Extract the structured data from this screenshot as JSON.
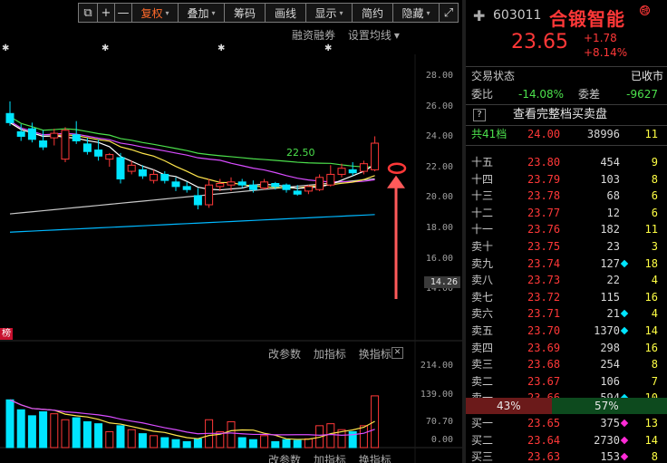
{
  "toolbar": {
    "items": [
      {
        "label": "复权",
        "dropdown": true,
        "active": true
      },
      {
        "label": "叠加",
        "dropdown": true,
        "active": false
      },
      {
        "label": "筹码",
        "dropdown": false,
        "active": false
      },
      {
        "label": "画线",
        "dropdown": false,
        "active": false
      },
      {
        "label": "显示",
        "dropdown": true,
        "active": false
      },
      {
        "label": "简约",
        "dropdown": false,
        "active": false
      },
      {
        "label": "隐藏",
        "dropdown": true,
        "active": false
      }
    ],
    "icons": [
      "copy-icon",
      "plus-icon",
      "minus-icon",
      "fullscreen-icon"
    ]
  },
  "chart_links": {
    "margin": "融资融券",
    "ma_setting": "设置均线",
    "ma_setting_arrow": "▾"
  },
  "price_axis": [
    "28.00",
    "26.00",
    "24.00",
    "22.00",
    "20.00",
    "18.00",
    "16.00",
    "14.00"
  ],
  "current_price_tag": "14.26",
  "ma_label": "22.50",
  "rank_tag": "榜",
  "indicator_links": {
    "params": "改参数",
    "add": "加指标",
    "switch": "换指标",
    "close": "✕"
  },
  "volume_axis": [
    "214.00",
    "139.00",
    "70.70",
    "0.00"
  ],
  "quote": {
    "code": "603011",
    "name": "合锻智能",
    "badge": "融",
    "price": "23.65",
    "change": "+1.78",
    "change_pct": "+8.14%",
    "trade_status_label": "交易状态",
    "trade_status_value": "已收市",
    "weibi_label": "委比",
    "weibi_value": "-14.08%",
    "weicha_label": "委差",
    "weicha_value": "-9627",
    "help_icon": "?",
    "full_book_link": "查看完整档买卖盘",
    "total_label": "共41档",
    "total_price": "24.00",
    "total_qty": "38996",
    "total_count": "11",
    "sell_levels": [
      {
        "level": "十五",
        "price": "23.80",
        "qty": "454",
        "mark": "",
        "count": "9"
      },
      {
        "level": "十四",
        "price": "23.79",
        "qty": "103",
        "mark": "",
        "count": "8"
      },
      {
        "level": "十三",
        "price": "23.78",
        "qty": "68",
        "mark": "",
        "count": "6"
      },
      {
        "level": "十二",
        "price": "23.77",
        "qty": "12",
        "mark": "",
        "count": "6"
      },
      {
        "level": "十一",
        "price": "23.76",
        "qty": "182",
        "mark": "",
        "count": "11"
      },
      {
        "level": "卖十",
        "price": "23.75",
        "qty": "23",
        "mark": "",
        "count": "3"
      },
      {
        "level": "卖九",
        "price": "23.74",
        "qty": "127",
        "mark": "cyan",
        "count": "18"
      },
      {
        "level": "卖八",
        "price": "23.73",
        "qty": "22",
        "mark": "",
        "count": "4"
      },
      {
        "level": "卖七",
        "price": "23.72",
        "qty": "115",
        "mark": "",
        "count": "16"
      },
      {
        "level": "卖六",
        "price": "23.71",
        "qty": "21",
        "mark": "cyan",
        "count": "4"
      },
      {
        "level": "卖五",
        "price": "23.70",
        "qty": "1370",
        "mark": "cyan",
        "count": "14"
      },
      {
        "level": "卖四",
        "price": "23.69",
        "qty": "298",
        "mark": "",
        "count": "16"
      },
      {
        "level": "卖三",
        "price": "23.68",
        "qty": "254",
        "mark": "",
        "count": "8"
      },
      {
        "level": "卖二",
        "price": "23.67",
        "qty": "106",
        "mark": "",
        "count": "7"
      },
      {
        "level": "卖一",
        "price": "23.66",
        "qty": "594",
        "mark": "cyan",
        "count": "10"
      }
    ],
    "ratio_buy": "43%",
    "ratio_sell": "57%",
    "buy_levels": [
      {
        "level": "买一",
        "price": "23.65",
        "qty": "375",
        "mark": "magenta",
        "count": "13"
      },
      {
        "level": "买二",
        "price": "23.64",
        "qty": "2730",
        "mark": "magenta",
        "count": "14"
      },
      {
        "level": "买三",
        "price": "23.63",
        "qty": "153",
        "mark": "magenta",
        "count": "8"
      }
    ]
  },
  "colors": {
    "up": "#ff3838",
    "down": "#00e5ff",
    "ma5": "#ffffff",
    "ma10": "#ffe64c",
    "ma20": "#d84cff",
    "ma30": "#4ce04c",
    "ma60": "#c8c8c8",
    "ma120": "#00b8ff"
  },
  "chart_data": {
    "type": "candlestick",
    "ylim": [
      14,
      28
    ],
    "candles": [
      {
        "o": 25.6,
        "h": 26.4,
        "l": 24.8,
        "c": 25.0
      },
      {
        "o": 24.4,
        "h": 24.9,
        "l": 23.8,
        "c": 24.1
      },
      {
        "o": 24.6,
        "h": 25.0,
        "l": 23.7,
        "c": 23.9
      },
      {
        "o": 23.8,
        "h": 24.5,
        "l": 23.2,
        "c": 23.4
      },
      {
        "o": 24.0,
        "h": 24.6,
        "l": 23.5,
        "c": 24.3
      },
      {
        "o": 22.6,
        "h": 24.7,
        "l": 22.4,
        "c": 24.5
      },
      {
        "o": 24.2,
        "h": 25.1,
        "l": 23.6,
        "c": 23.8
      },
      {
        "o": 23.6,
        "h": 24.0,
        "l": 22.9,
        "c": 23.1
      },
      {
        "o": 23.2,
        "h": 23.9,
        "l": 22.5,
        "c": 22.8
      },
      {
        "o": 22.6,
        "h": 23.0,
        "l": 22.1,
        "c": 22.9
      },
      {
        "o": 22.7,
        "h": 23.0,
        "l": 21.0,
        "c": 21.3
      },
      {
        "o": 21.8,
        "h": 22.5,
        "l": 21.6,
        "c": 22.2
      },
      {
        "o": 21.9,
        "h": 22.2,
        "l": 21.3,
        "c": 21.5
      },
      {
        "o": 21.2,
        "h": 21.9,
        "l": 21.0,
        "c": 21.6
      },
      {
        "o": 21.6,
        "h": 21.8,
        "l": 21.0,
        "c": 21.2
      },
      {
        "o": 21.1,
        "h": 21.4,
        "l": 20.5,
        "c": 20.8
      },
      {
        "o": 20.8,
        "h": 21.1,
        "l": 20.4,
        "c": 20.6
      },
      {
        "o": 20.2,
        "h": 20.7,
        "l": 19.3,
        "c": 19.6
      },
      {
        "o": 19.6,
        "h": 21.3,
        "l": 19.4,
        "c": 20.9
      },
      {
        "o": 20.8,
        "h": 21.3,
        "l": 20.5,
        "c": 21.0
      },
      {
        "o": 20.9,
        "h": 21.4,
        "l": 20.5,
        "c": 21.1
      },
      {
        "o": 21.1,
        "h": 21.3,
        "l": 20.7,
        "c": 20.9
      },
      {
        "o": 20.9,
        "h": 21.2,
        "l": 20.4,
        "c": 20.6
      },
      {
        "o": 20.7,
        "h": 21.3,
        "l": 20.6,
        "c": 21.1
      },
      {
        "o": 21.0,
        "h": 21.1,
        "l": 20.6,
        "c": 20.8
      },
      {
        "o": 20.9,
        "h": 21.0,
        "l": 20.4,
        "c": 20.6
      },
      {
        "o": 20.5,
        "h": 20.9,
        "l": 20.2,
        "c": 20.3
      },
      {
        "o": 20.5,
        "h": 20.9,
        "l": 20.3,
        "c": 20.8
      },
      {
        "o": 20.6,
        "h": 21.6,
        "l": 20.5,
        "c": 21.4
      },
      {
        "o": 20.9,
        "h": 22.2,
        "l": 20.8,
        "c": 21.6
      },
      {
        "o": 21.6,
        "h": 22.3,
        "l": 21.4,
        "c": 22.0
      },
      {
        "o": 21.9,
        "h": 22.4,
        "l": 21.5,
        "c": 21.7
      },
      {
        "o": 21.8,
        "h": 22.5,
        "l": 21.6,
        "c": 22.3
      },
      {
        "o": 21.9,
        "h": 24.1,
        "l": 21.8,
        "c": 23.65
      }
    ],
    "volume": {
      "ylim": [
        0,
        214
      ],
      "values": [
        {
          "v": 120,
          "up": false
        },
        {
          "v": 95,
          "up": false
        },
        {
          "v": 80,
          "up": false
        },
        {
          "v": 90,
          "up": false
        },
        {
          "v": 85,
          "up": true
        },
        {
          "v": 70,
          "up": true
        },
        {
          "v": 75,
          "up": false
        },
        {
          "v": 65,
          "up": false
        },
        {
          "v": 60,
          "up": false
        },
        {
          "v": 40,
          "up": true
        },
        {
          "v": 55,
          "up": false
        },
        {
          "v": 45,
          "up": true
        },
        {
          "v": 35,
          "up": false
        },
        {
          "v": 30,
          "up": true
        },
        {
          "v": 25,
          "up": false
        },
        {
          "v": 20,
          "up": false
        },
        {
          "v": 15,
          "up": false
        },
        {
          "v": 22,
          "up": false
        },
        {
          "v": 70,
          "up": true
        },
        {
          "v": 40,
          "up": true
        },
        {
          "v": 65,
          "up": true
        },
        {
          "v": 25,
          "up": false
        },
        {
          "v": 20,
          "up": false
        },
        {
          "v": 30,
          "up": true
        },
        {
          "v": 15,
          "up": false
        },
        {
          "v": 20,
          "up": false
        },
        {
          "v": 18,
          "up": false
        },
        {
          "v": 22,
          "up": true
        },
        {
          "v": 55,
          "up": true
        },
        {
          "v": 60,
          "up": true
        },
        {
          "v": 45,
          "up": true
        },
        {
          "v": 40,
          "up": false
        },
        {
          "v": 55,
          "up": true
        },
        {
          "v": 130,
          "up": true
        }
      ]
    }
  }
}
